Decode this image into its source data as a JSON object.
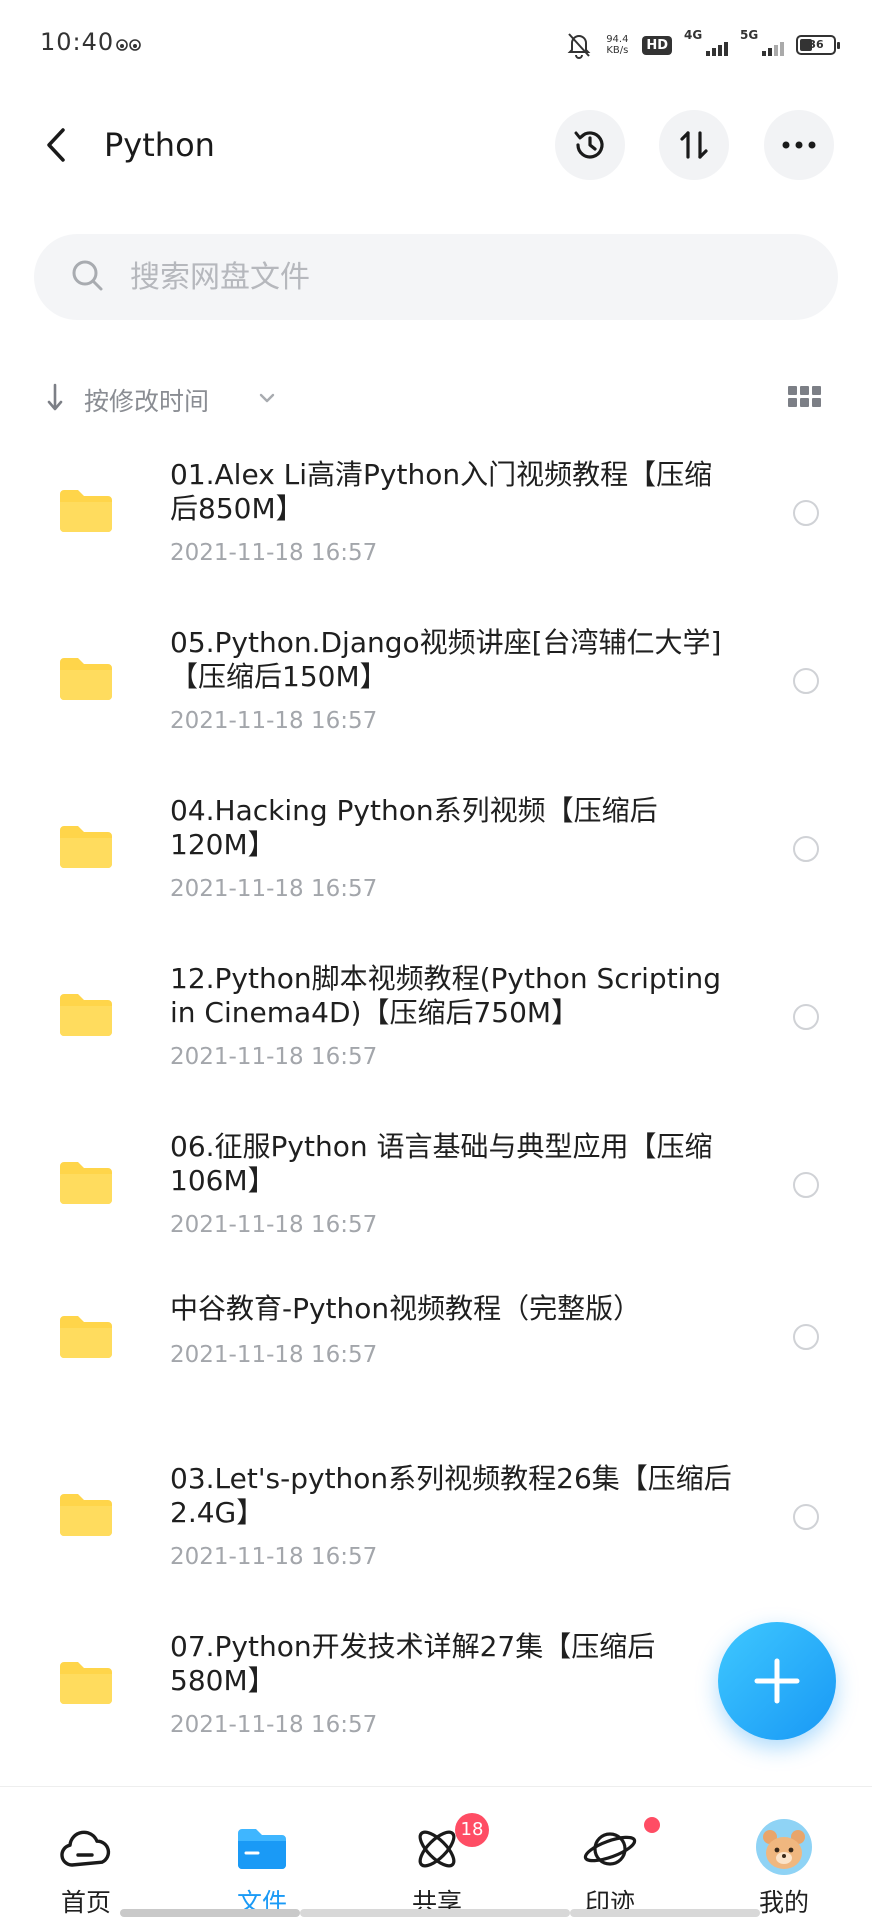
{
  "status_bar": {
    "time": "10:40",
    "net_speed_value": "94.4",
    "net_speed_unit": "KB/s",
    "hd_label": "HD",
    "sim1_label": "4G",
    "sim2_label": "5G",
    "battery_level": "36"
  },
  "header": {
    "title": "Python"
  },
  "search": {
    "placeholder": "搜索网盘文件"
  },
  "sort": {
    "label": "按修改时间"
  },
  "files": [
    {
      "name": "01.Alex Li高清Python入门视频教程【压缩后850M】",
      "date": "2021-11-18 16:57"
    },
    {
      "name": "05.Python.Django视频讲座[台湾辅仁大学]【压缩后150M】",
      "date": "2021-11-18 16:57"
    },
    {
      "name": "04.Hacking Python系列视频【压缩后120M】",
      "date": "2021-11-18 16:57"
    },
    {
      "name": "12.Python脚本视频教程(Python Scripting in Cinema4D)【压缩后750M】",
      "date": "2021-11-18 16:57"
    },
    {
      "name": "06.征服Python 语言基础与典型应用【压缩106M】",
      "date": "2021-11-18 16:57"
    },
    {
      "name": "中谷教育-Python视频教程（完整版）",
      "date": "2021-11-18 16:57"
    },
    {
      "name": "03.Let's-python系列视频教程26集【压缩后2.4G】",
      "date": "2021-11-18 16:57"
    },
    {
      "name": "07.Python开发技术详解27集【压缩后580M】",
      "date": "2021-11-18 16:57"
    }
  ],
  "bottom_nav": {
    "items": [
      {
        "label": "首页",
        "icon": "cloud-home-icon"
      },
      {
        "label": "文件",
        "icon": "folder-icon"
      },
      {
        "label": "共享",
        "icon": "atom-share-icon",
        "badge": "18"
      },
      {
        "label": "印迹",
        "icon": "planet-icon"
      },
      {
        "label": "我的",
        "icon": "avatar-icon"
      }
    ],
    "active_index": 1
  },
  "colors": {
    "accent": "#1a9af6",
    "folder": "#ffd54a",
    "badge": "#ff4d64"
  }
}
